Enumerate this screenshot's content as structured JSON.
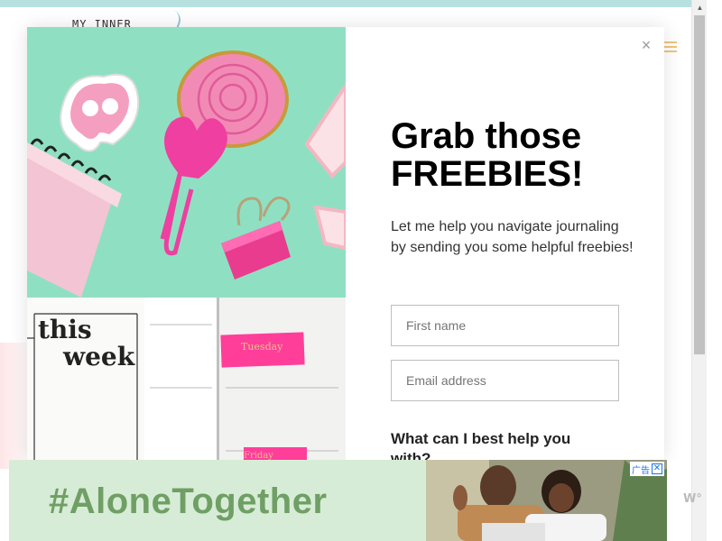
{
  "site": {
    "logo_text": "MY INNER"
  },
  "modal": {
    "title": "Grab those FREEBIES!",
    "description": "Let me help you navigate journaling by sending you some helpful freebies!",
    "first_name_placeholder": "First name",
    "email_placeholder": "Email address",
    "question": "What can I best help you with?",
    "close_label": "×"
  },
  "hero": {
    "journal_heading_line1": "this",
    "journal_heading_line2": "week",
    "tape_label_1": "Tuesday",
    "tape_label_2": "Friday"
  },
  "ad": {
    "headline": "#AloneTogether",
    "choice_label": "广告",
    "close_label": "✕",
    "side_logo": "W°"
  },
  "colors": {
    "mint": "#8fe0c3",
    "pink": "#ef3fa0",
    "ad_green": "#6f9f64",
    "ad_bg": "#d7ecd6",
    "top_strip": "#b7e1de"
  }
}
